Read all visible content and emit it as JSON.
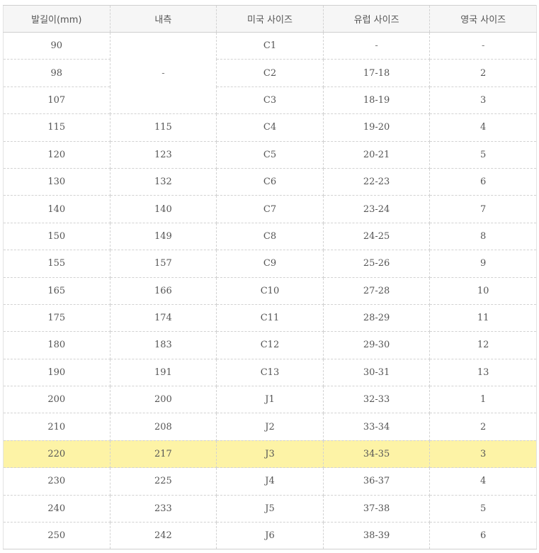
{
  "table": {
    "headers": [
      "발길이(mm)",
      "내측",
      "미국 사이즈",
      "유럽 사이즈",
      "영국 사이즈"
    ],
    "merged_inner_dash": "-",
    "rows": [
      {
        "foot": "90",
        "inner": null,
        "us": "C1",
        "eu": "-",
        "uk": "-"
      },
      {
        "foot": "98",
        "inner": null,
        "us": "C2",
        "eu": "17-18",
        "uk": "2"
      },
      {
        "foot": "107",
        "inner": null,
        "us": "C3",
        "eu": "18-19",
        "uk": "3"
      },
      {
        "foot": "115",
        "inner": "115",
        "us": "C4",
        "eu": "19-20",
        "uk": "4"
      },
      {
        "foot": "120",
        "inner": "123",
        "us": "C5",
        "eu": "20-21",
        "uk": "5"
      },
      {
        "foot": "130",
        "inner": "132",
        "us": "C6",
        "eu": "22-23",
        "uk": "6"
      },
      {
        "foot": "140",
        "inner": "140",
        "us": "C7",
        "eu": "23-24",
        "uk": "7"
      },
      {
        "foot": "150",
        "inner": "149",
        "us": "C8",
        "eu": "24-25",
        "uk": "8"
      },
      {
        "foot": "155",
        "inner": "157",
        "us": "C9",
        "eu": "25-26",
        "uk": "9"
      },
      {
        "foot": "165",
        "inner": "166",
        "us": "C10",
        "eu": "27-28",
        "uk": "10"
      },
      {
        "foot": "175",
        "inner": "174",
        "us": "C11",
        "eu": "28-29",
        "uk": "11"
      },
      {
        "foot": "180",
        "inner": "183",
        "us": "C12",
        "eu": "29-30",
        "uk": "12"
      },
      {
        "foot": "190",
        "inner": "191",
        "us": "C13",
        "eu": "30-31",
        "uk": "13"
      },
      {
        "foot": "200",
        "inner": "200",
        "us": "J1",
        "eu": "32-33",
        "uk": "1"
      },
      {
        "foot": "210",
        "inner": "208",
        "us": "J2",
        "eu": "33-34",
        "uk": "2"
      },
      {
        "foot": "220",
        "inner": "217",
        "us": "J3",
        "eu": "34-35",
        "uk": "3",
        "highlight": true
      },
      {
        "foot": "230",
        "inner": "225",
        "us": "J4",
        "eu": "36-37",
        "uk": "4"
      },
      {
        "foot": "240",
        "inner": "233",
        "us": "J5",
        "eu": "37-38",
        "uk": "5"
      },
      {
        "foot": "250",
        "inner": "242",
        "us": "J6",
        "eu": "38-39",
        "uk": "6"
      }
    ],
    "colors": {
      "header_bg": "#f6f6f6",
      "highlight_bg": "#fdf3a6",
      "text": "#555555",
      "border": "#d2d2d2"
    }
  }
}
